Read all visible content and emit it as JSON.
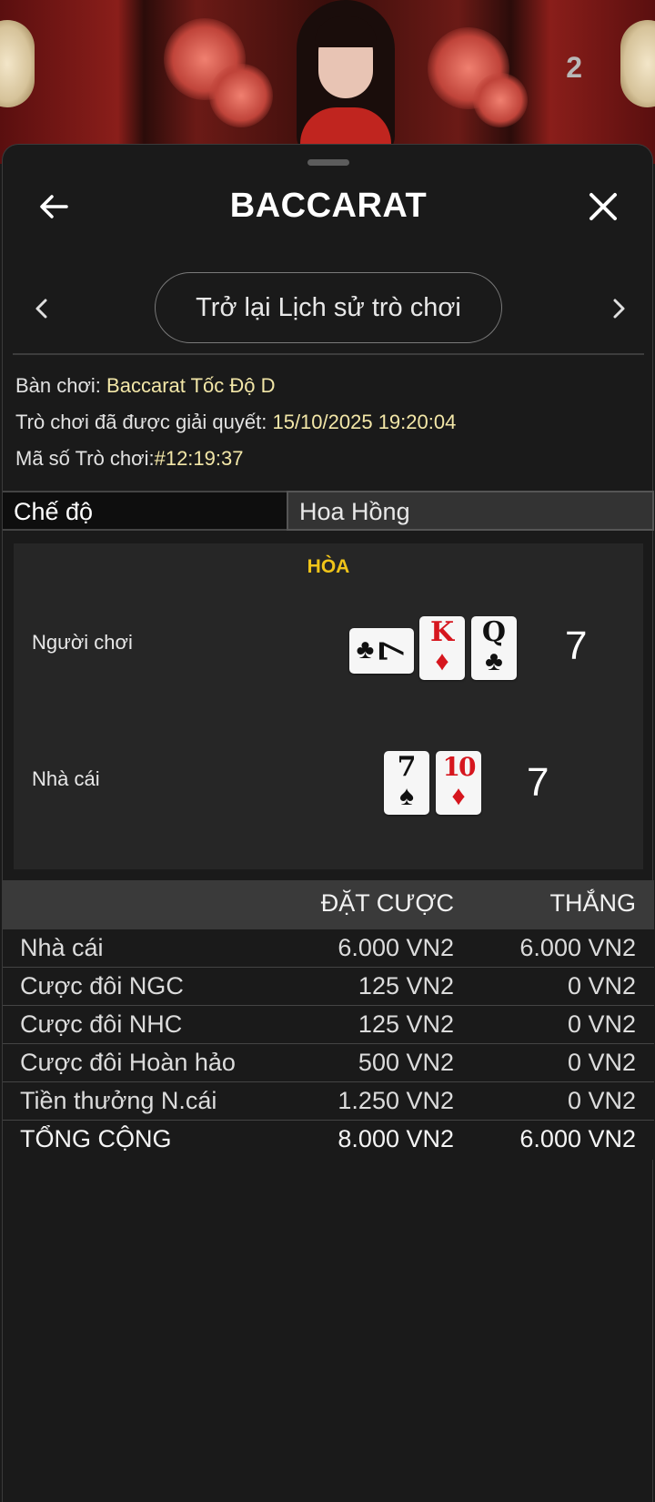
{
  "video": {
    "counter": "2"
  },
  "header": {
    "title": "BACCARAT"
  },
  "nav": {
    "history_button": "Trở lại Lịch sử trò chơi"
  },
  "info": {
    "table_label": "Bàn chơi:",
    "table_value": "Baccarat Tốc Độ D",
    "settled_label": "Trò chơi đã được giải quyết:",
    "settled_value": "15/10/2025 19:20:04",
    "game_id_label": "Mã số Trò chơi:",
    "game_id_value": "#12:19:37"
  },
  "mode": {
    "label": "Chế độ",
    "value": "Hoa Hồng"
  },
  "result": {
    "outcome": "HÒA",
    "player": {
      "name": "Người chơi",
      "score": "7",
      "cards": [
        {
          "rank": "7",
          "suit": "♣",
          "color": "black",
          "rotated": true
        },
        {
          "rank": "K",
          "suit": "♦",
          "color": "red"
        },
        {
          "rank": "Q",
          "suit": "♣",
          "color": "black"
        }
      ]
    },
    "banker": {
      "name": "Nhà cái",
      "score": "7",
      "cards": [
        {
          "rank": "7",
          "suit": "♠",
          "color": "black"
        },
        {
          "rank": "10",
          "suit": "♦",
          "color": "red"
        }
      ]
    }
  },
  "bets": {
    "header": {
      "bet": "ĐẶT CƯỢC",
      "win": "THẮNG"
    },
    "rows": [
      {
        "name": "Nhà cái",
        "bet": "6.000 VN2",
        "win": "6.000 VN2"
      },
      {
        "name": "Cược đôi NGC",
        "bet": "125 VN2",
        "win": "0 VN2"
      },
      {
        "name": "Cược đôi NHC",
        "bet": "125 VN2",
        "win": "0 VN2"
      },
      {
        "name": "Cược đôi Hoàn hảo",
        "bet": "500 VN2",
        "win": "0 VN2"
      },
      {
        "name": "Tiền thưởng N.cái",
        "bet": "1.250 VN2",
        "win": "0 VN2"
      }
    ],
    "total": {
      "name": "TỔNG CỘNG",
      "bet": "8.000 VN2",
      "win": "6.000 VN2"
    }
  },
  "colors": {
    "accent_yellow": "#f0c419",
    "info_value": "#f3e7a8",
    "card_red": "#d6161e"
  }
}
